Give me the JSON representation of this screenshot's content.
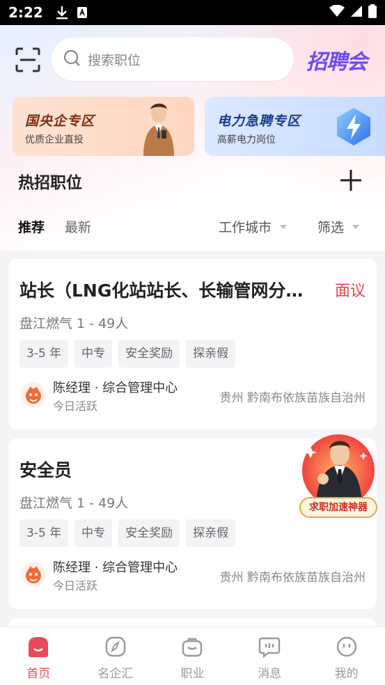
{
  "status_bar": {
    "time": "2:22"
  },
  "header": {
    "search_placeholder": "搜索职位",
    "brand_text": "招聘会",
    "banners": [
      {
        "title": "国央企专区",
        "subtitle": "优质企业直投"
      },
      {
        "title": "电力急聘专区",
        "subtitle": "高薪电力岗位"
      }
    ],
    "section_title": "热招职位"
  },
  "filters": {
    "tabs": [
      "推荐",
      "最新"
    ],
    "dropdowns": [
      "工作城市",
      "筛选"
    ]
  },
  "jobs": [
    {
      "title": "站长（LNG化站站长、长输管网分…",
      "salary": "面议",
      "company": "盘江燃气 1 - 49人",
      "tags": [
        "3-5 年",
        "中专",
        "安全奖励",
        "探亲假"
      ],
      "recruiter": "陈经理 · 综合管理中心",
      "activity": "今日活跃",
      "location": "贵州 黔南布依族苗族自治州"
    },
    {
      "title": "安全员",
      "salary": "",
      "company": "盘江燃气 1 - 49人",
      "tags": [
        "3-5 年",
        "中专",
        "安全奖励",
        "探亲假"
      ],
      "recruiter": "陈经理 · 综合管理中心",
      "activity": "今日活跃",
      "location": "贵州 黔南布依族苗族自治州"
    }
  ],
  "promo": {
    "label": "求职加速神器"
  },
  "bottom_nav": [
    {
      "label": "首页",
      "icon": "home-icon",
      "active": true
    },
    {
      "label": "名企汇",
      "icon": "compass-icon",
      "active": false
    },
    {
      "label": "职业",
      "icon": "briefcase-icon",
      "active": false
    },
    {
      "label": "消息",
      "icon": "chat-icon",
      "active": false
    },
    {
      "label": "我的",
      "icon": "profile-icon",
      "active": false
    }
  ],
  "colors": {
    "accent": "#e84a57",
    "salary": "#e5414b",
    "brand": "#6d4cf0"
  }
}
